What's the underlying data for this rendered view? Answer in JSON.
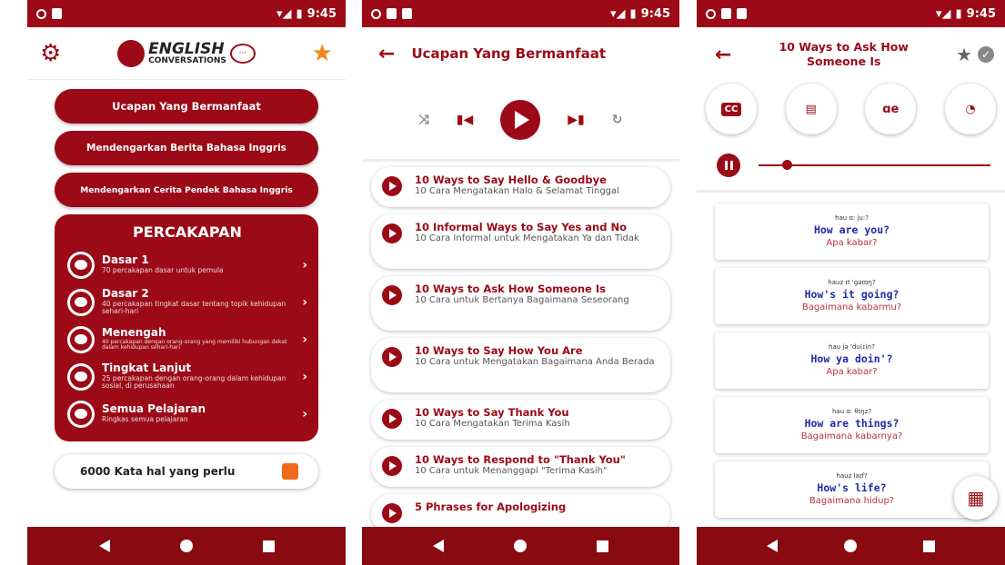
{
  "status_bar": {
    "time": "9:45"
  },
  "colors": {
    "primary": "#9b0a16",
    "accent_star": "#ef8a1c",
    "english_text": "#1f2aa8",
    "indonesian_text": "#b5323d"
  },
  "screen1": {
    "logo": {
      "line1": "ENGLISH",
      "line2": "CONVERSATIONS",
      "bubble": "···"
    },
    "icons": {
      "settings": "gear-icon",
      "favorite": "star-icon"
    },
    "menu": [
      {
        "label": "Ucapan Yang Bermanfaat"
      },
      {
        "label": "Mendengarkan Berita Bahasa Inggris"
      },
      {
        "label": "Mendengarkan Cerita Pendek Bahasa Inggris"
      }
    ],
    "percakapan": {
      "title": "PERCAKAPAN",
      "items": [
        {
          "name": "Dasar 1",
          "desc": "70 percakapan dasar untuk pemula"
        },
        {
          "name": "Dasar 2",
          "desc": "40 percakapan tingkat dasar tentang topik kehidupan sehari-hari"
        },
        {
          "name": "Menengah",
          "desc": "40 percakapan dengan orang-orang yang memiliki hubungan dekat dalam kehidupan sehari-hari"
        },
        {
          "name": "Tingkat Lanjut",
          "desc": "25 percakapan dengan orang-orang dalam kehidupan sosial, di perusahaan"
        },
        {
          "name": "Semua Pelajaran",
          "desc": "Ringkas semua pelajaran"
        }
      ]
    },
    "words_button": "6000 Kata hal yang perlu"
  },
  "screen2": {
    "title": "Ucapan Yang Bermanfaat",
    "lessons": [
      {
        "title": "10 Ways to Say Hello & Goodbye",
        "subtitle": "10 Cara Mengatakan Halo & Selamat Tinggal"
      },
      {
        "title": "10 Informal Ways to Say Yes and No",
        "subtitle": "10 Cara Informal untuk Mengatakan Ya dan Tidak"
      },
      {
        "title": "10 Ways to Ask How Someone Is",
        "subtitle": "10 Cara untuk Bertanya Bagaimana Seseorang"
      },
      {
        "title": "10 Ways to Say How You Are",
        "subtitle": "10 Cara untuk Mengatakan Bagaimana Anda Berada"
      },
      {
        "title": "10 Ways to Say Thank You",
        "subtitle": "10 Cara Mengatakan Terima Kasih"
      },
      {
        "title": "10 Ways to Respond to \"Thank You\"",
        "subtitle": "10 Cara untuk Menanggapi \"Terima Kasih\""
      },
      {
        "title": "5 Phrases for Apologizing",
        "subtitle": ""
      }
    ]
  },
  "screen3": {
    "title": "10 Ways to Ask How Someone Is",
    "tools": {
      "subtitles": "CC",
      "translate": "translate-icon",
      "pronunciation": "ɑe",
      "speed": "speed-icon"
    },
    "playback_progress": 0.1,
    "phrases": [
      {
        "ipa": "hau  ɑ:   ju:?",
        "english": "How are you?",
        "indonesian": "Apa kabar?"
      },
      {
        "ipa": "hauz   ɪt   'gəʊɪŋ?",
        "english": "How's it going?",
        "indonesian": "Bagaimana kabarmu?"
      },
      {
        "ipa": "hau   jə   'du(ɪ)n?",
        "english": "How ya doin'?",
        "indonesian": "Apa kabar?"
      },
      {
        "ipa": "hau   ɑ:   θɪŋz?",
        "english": "How are things?",
        "indonesian": "Bagaimana kabarnya?"
      },
      {
        "ipa": "hauz   laɪf?",
        "english": "How's life?",
        "indonesian": "Bagaimana hidup?"
      }
    ]
  }
}
